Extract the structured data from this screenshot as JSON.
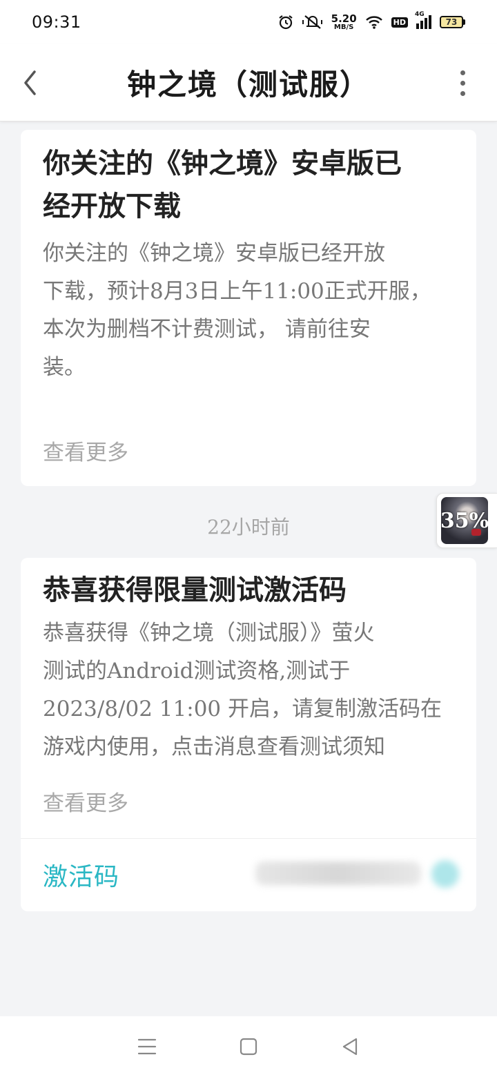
{
  "status_bar": {
    "time": "09:31",
    "net_speed_value": "5.20",
    "net_speed_unit": "MB/S",
    "hd_label": "HD",
    "signal_label": "4G",
    "battery_level": "73",
    "icons": [
      "alarm-icon",
      "mute-icon",
      "wifi-icon",
      "hd-icon",
      "signal-icon",
      "battery-icon"
    ]
  },
  "header": {
    "title": "钟之境（测试服）",
    "back_icon": "chevron-left-icon",
    "menu_icon": "more-vertical-icon"
  },
  "messages": [
    {
      "title_line1": "你关注的《钟之境》安卓版已",
      "title_line2": "经开放下载",
      "body_lines": [
        "你关注的《钟之境》安卓版已经开放",
        "下载，预计8月3日上午11:00正式开服，",
        "本次为删档不计费测试， 请前往安",
        "装。"
      ],
      "more_label": "查看更多"
    },
    {
      "timestamp": "22小时前",
      "title": "恭喜获得限量测试激活码",
      "body_lines": [
        "恭喜获得《钟之境（测试服）》萤火",
        "测试的Android测试资格,测试于",
        "2023/8/02 11:00 开启，请复制激活码在",
        "游戏内使用，点击消息查看测试须知"
      ],
      "more_label": "查看更多",
      "code_label": "激活码",
      "code_label_color": "#2ab7c4"
    }
  ],
  "floating_widget": {
    "percent": "35%"
  },
  "nav_bar": {
    "icons": [
      "menu-icon",
      "home-square-icon",
      "back-triangle-icon"
    ]
  }
}
